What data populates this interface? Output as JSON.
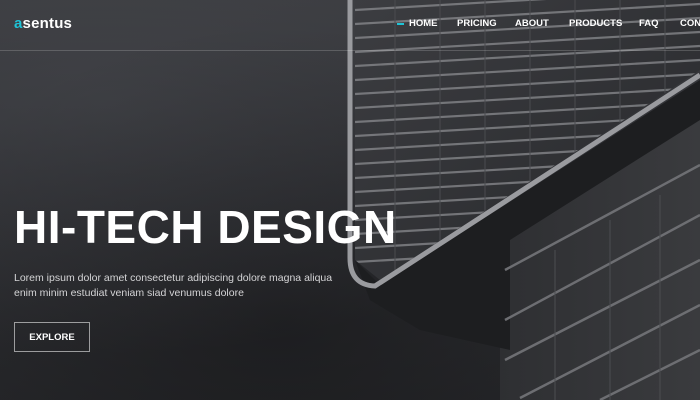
{
  "brand": {
    "logo_first_letter": "a",
    "logo_rest": "sentus",
    "accent_color": "#1ec3d6"
  },
  "nav": {
    "items": [
      {
        "label": "HOME",
        "active": true
      },
      {
        "label": "PRICING",
        "active": false
      },
      {
        "label": "ABOUT",
        "active": false
      },
      {
        "label": "PRODUCTS",
        "active": false
      },
      {
        "label": "FAQ",
        "active": false
      },
      {
        "label": "CONT",
        "active": false
      }
    ]
  },
  "hero": {
    "headline": "HI-TECH DESIGN",
    "subtext_line1": "Lorem ipsum dolor amet consectetur adipiscing dolore magna aliqua",
    "subtext_line2": "enim minim estudiat veniam siad venumus dolore",
    "cta_label": "EXPLORE",
    "background": "dark grayscale photo of modern building facade with louvers"
  }
}
